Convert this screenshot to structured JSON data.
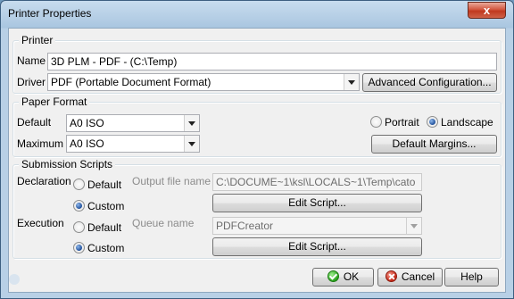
{
  "window": {
    "title": "Printer Properties",
    "close_glyph": "x"
  },
  "printer": {
    "legend": "Printer",
    "name_label": "Name",
    "name_value": "3D PLM - PDF - (C:\\Temp)",
    "driver_label": "Driver",
    "driver_value": "PDF (Portable Document Format)",
    "advanced_button": "Advanced Configuration..."
  },
  "paper": {
    "legend": "Paper Format",
    "default_label": "Default",
    "default_value": "A0 ISO",
    "maximum_label": "Maximum",
    "maximum_value": "A0 ISO",
    "portrait_label": "Portrait",
    "landscape_label": "Landscape",
    "orientation_selected": "Landscape",
    "margins_button": "Default Margins..."
  },
  "scripts": {
    "legend": "Submission Scripts",
    "declaration_label": "Declaration",
    "declaration_default": "Default",
    "declaration_custom": "Custom",
    "declaration_selected": "Custom",
    "output_file_label": "Output file name",
    "output_file_value": "C:\\DOCUME~1\\ksl\\LOCALS~1\\Temp\\cato",
    "edit_script_1": "Edit Script...",
    "execution_label": "Execution",
    "execution_default": "Default",
    "execution_custom": "Custom",
    "execution_selected": "Custom",
    "queue_label": "Queue name",
    "queue_value": "PDFCreator",
    "edit_script_2": "Edit Script..."
  },
  "footer": {
    "ok": "OK",
    "cancel": "Cancel",
    "help": "Help"
  },
  "colors": {
    "title_bar": "#a9c6e0",
    "close_button": "#c0391f",
    "client_bg": "#f0f0f0"
  }
}
